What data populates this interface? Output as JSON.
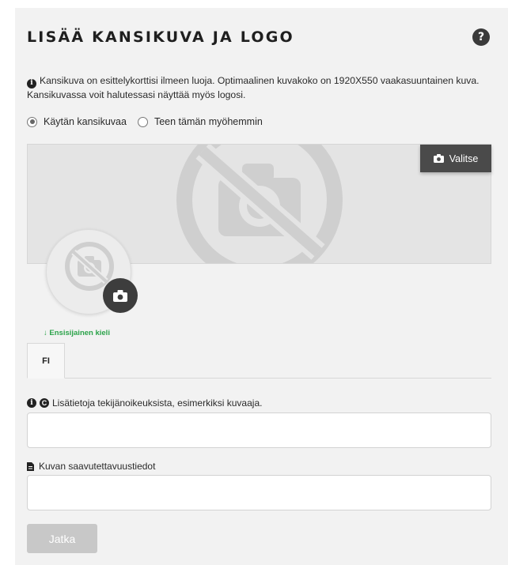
{
  "header": {
    "title": "LISÄÄ KANSIKUVA JA LOGO",
    "help_icon": "?"
  },
  "info": {
    "icon": "info-icon",
    "text": "Kansikuva on esittelykorttisi ilmeen luoja. Optimaalinen kuvakoko on 1920X550 vaakasuuntainen kuva. Kansikuvassa voit halutessasi näyttää myös logosi."
  },
  "cover_options": {
    "selected": "use_cover",
    "options": [
      {
        "id": "use_cover",
        "label": "Käytän kansikuvaa"
      },
      {
        "id": "later",
        "label": "Teen tämän myöhemmin"
      }
    ]
  },
  "cover": {
    "select_button_label": "Valitse",
    "select_icon": "camera-icon",
    "placeholder_icon": "no-photo-icon"
  },
  "logo": {
    "placeholder_icon": "no-photo-icon",
    "upload_icon": "camera-icon"
  },
  "language": {
    "primary_label": "Ensisijainen kieli",
    "tabs": [
      {
        "label": "FI"
      }
    ]
  },
  "fields": {
    "copyright_label": "Lisätietoja tekijänoikeuksista, esimerkiksi kuvaaja.",
    "copyright_value": "",
    "accessibility_label": "Kuvan saavutettavuustiedot",
    "accessibility_value": ""
  },
  "actions": {
    "continue_label": "Jatka"
  },
  "colors": {
    "panel_bg": "#f2f2f2",
    "dark_button": "#4a4a4a",
    "accent_green": "#2ba34a",
    "disabled_button": "#c8c8c8"
  }
}
